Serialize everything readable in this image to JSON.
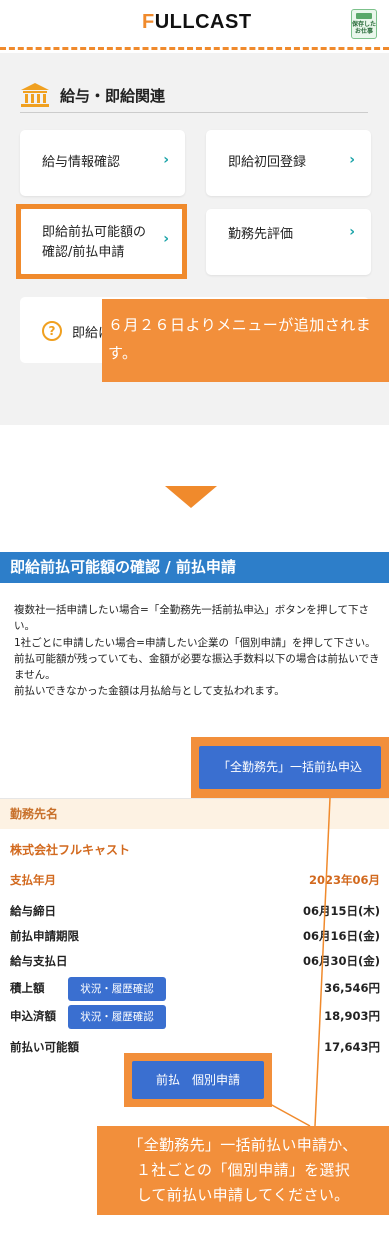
{
  "header": {
    "logo_prefix": "F",
    "logo_rest": "ULLCAST",
    "save_button": "保存した\nお仕事"
  },
  "menu": {
    "section_title": "給与・即給関連",
    "items": [
      {
        "label": "給与情報確認"
      },
      {
        "label": "即給初回登録"
      },
      {
        "label": "即給前払可能額の\n確認/前払申請"
      },
      {
        "label": "勤務先評価"
      }
    ],
    "faq_label": "即給に"
  },
  "callout_top": "６月２６日よりメニューが追加されます。",
  "page": {
    "title": "即給前払可能額の確認 / 前払申請",
    "notice": [
      "複数社一括申請したい場合=「全勤務先一括前払申込」ボタンを押して下さい。",
      "1社ごとに申請したい場合=申請したい企業の「個別申請」を押して下さい。",
      "前払可能額が残っていても、金額が必要な振込手数料以下の場合は前払いできません。",
      "前払いできなかった金額は月払給与として支払われます。"
    ],
    "bulk_button": "「全勤務先」一括前払申込"
  },
  "detail": {
    "header": "勤務先名",
    "company": "株式会社フルキャスト",
    "rows": [
      {
        "label": "支払年月",
        "value": "2023年06月"
      },
      {
        "label": "給与締日",
        "value": "06月15日(木)"
      },
      {
        "label": "前払申請期限",
        "value": "06月16日(金)"
      },
      {
        "label": "給与支払日",
        "value": "06月30日(金)"
      },
      {
        "label": "積上額",
        "value": "36,546円",
        "button": "状況・履歴確認"
      },
      {
        "label": "申込済額",
        "value": "18,903円",
        "button": "状況・履歴確認"
      },
      {
        "label": "前払い可能額",
        "value": "17,643円"
      }
    ],
    "individual_button": "前払　個別申請"
  },
  "callout_bottom": "「全勤務先」一括前払い申請か、\n１社ごとの「個別申請」を選択\nして前払い申請してください。",
  "colors": {
    "accent_orange": "#f08a2c",
    "callout_orange": "#f28f3b",
    "primary_blue": "#2d7ec9",
    "button_blue": "#3a6fd0",
    "chevron_teal": "#1aa3a8"
  }
}
